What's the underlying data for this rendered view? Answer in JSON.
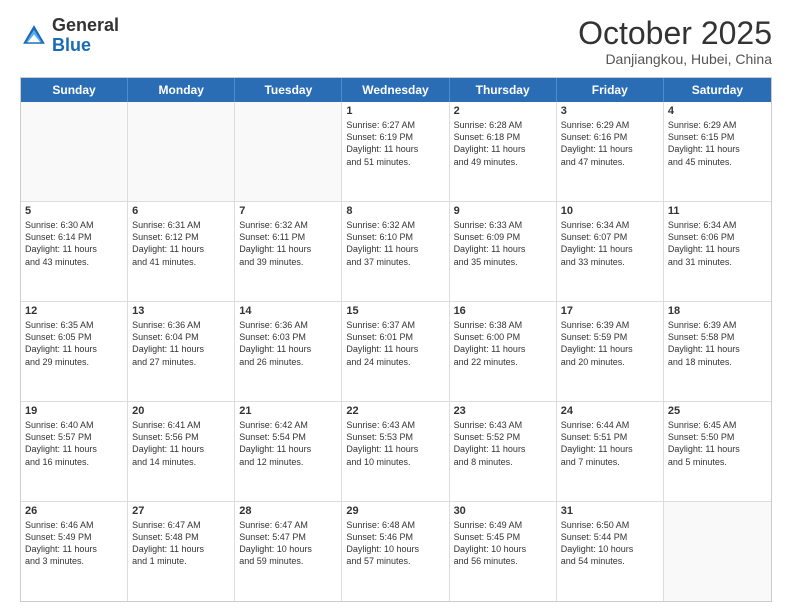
{
  "header": {
    "logo_general": "General",
    "logo_blue": "Blue",
    "month_title": "October 2025",
    "location": "Danjiangkou, Hubei, China"
  },
  "weekdays": [
    "Sunday",
    "Monday",
    "Tuesday",
    "Wednesday",
    "Thursday",
    "Friday",
    "Saturday"
  ],
  "rows": [
    [
      {
        "day": "",
        "text": ""
      },
      {
        "day": "",
        "text": ""
      },
      {
        "day": "",
        "text": ""
      },
      {
        "day": "1",
        "text": "Sunrise: 6:27 AM\nSunset: 6:19 PM\nDaylight: 11 hours\nand 51 minutes."
      },
      {
        "day": "2",
        "text": "Sunrise: 6:28 AM\nSunset: 6:18 PM\nDaylight: 11 hours\nand 49 minutes."
      },
      {
        "day": "3",
        "text": "Sunrise: 6:29 AM\nSunset: 6:16 PM\nDaylight: 11 hours\nand 47 minutes."
      },
      {
        "day": "4",
        "text": "Sunrise: 6:29 AM\nSunset: 6:15 PM\nDaylight: 11 hours\nand 45 minutes."
      }
    ],
    [
      {
        "day": "5",
        "text": "Sunrise: 6:30 AM\nSunset: 6:14 PM\nDaylight: 11 hours\nand 43 minutes."
      },
      {
        "day": "6",
        "text": "Sunrise: 6:31 AM\nSunset: 6:12 PM\nDaylight: 11 hours\nand 41 minutes."
      },
      {
        "day": "7",
        "text": "Sunrise: 6:32 AM\nSunset: 6:11 PM\nDaylight: 11 hours\nand 39 minutes."
      },
      {
        "day": "8",
        "text": "Sunrise: 6:32 AM\nSunset: 6:10 PM\nDaylight: 11 hours\nand 37 minutes."
      },
      {
        "day": "9",
        "text": "Sunrise: 6:33 AM\nSunset: 6:09 PM\nDaylight: 11 hours\nand 35 minutes."
      },
      {
        "day": "10",
        "text": "Sunrise: 6:34 AM\nSunset: 6:07 PM\nDaylight: 11 hours\nand 33 minutes."
      },
      {
        "day": "11",
        "text": "Sunrise: 6:34 AM\nSunset: 6:06 PM\nDaylight: 11 hours\nand 31 minutes."
      }
    ],
    [
      {
        "day": "12",
        "text": "Sunrise: 6:35 AM\nSunset: 6:05 PM\nDaylight: 11 hours\nand 29 minutes."
      },
      {
        "day": "13",
        "text": "Sunrise: 6:36 AM\nSunset: 6:04 PM\nDaylight: 11 hours\nand 27 minutes."
      },
      {
        "day": "14",
        "text": "Sunrise: 6:36 AM\nSunset: 6:03 PM\nDaylight: 11 hours\nand 26 minutes."
      },
      {
        "day": "15",
        "text": "Sunrise: 6:37 AM\nSunset: 6:01 PM\nDaylight: 11 hours\nand 24 minutes."
      },
      {
        "day": "16",
        "text": "Sunrise: 6:38 AM\nSunset: 6:00 PM\nDaylight: 11 hours\nand 22 minutes."
      },
      {
        "day": "17",
        "text": "Sunrise: 6:39 AM\nSunset: 5:59 PM\nDaylight: 11 hours\nand 20 minutes."
      },
      {
        "day": "18",
        "text": "Sunrise: 6:39 AM\nSunset: 5:58 PM\nDaylight: 11 hours\nand 18 minutes."
      }
    ],
    [
      {
        "day": "19",
        "text": "Sunrise: 6:40 AM\nSunset: 5:57 PM\nDaylight: 11 hours\nand 16 minutes."
      },
      {
        "day": "20",
        "text": "Sunrise: 6:41 AM\nSunset: 5:56 PM\nDaylight: 11 hours\nand 14 minutes."
      },
      {
        "day": "21",
        "text": "Sunrise: 6:42 AM\nSunset: 5:54 PM\nDaylight: 11 hours\nand 12 minutes."
      },
      {
        "day": "22",
        "text": "Sunrise: 6:43 AM\nSunset: 5:53 PM\nDaylight: 11 hours\nand 10 minutes."
      },
      {
        "day": "23",
        "text": "Sunrise: 6:43 AM\nSunset: 5:52 PM\nDaylight: 11 hours\nand 8 minutes."
      },
      {
        "day": "24",
        "text": "Sunrise: 6:44 AM\nSunset: 5:51 PM\nDaylight: 11 hours\nand 7 minutes."
      },
      {
        "day": "25",
        "text": "Sunrise: 6:45 AM\nSunset: 5:50 PM\nDaylight: 11 hours\nand 5 minutes."
      }
    ],
    [
      {
        "day": "26",
        "text": "Sunrise: 6:46 AM\nSunset: 5:49 PM\nDaylight: 11 hours\nand 3 minutes."
      },
      {
        "day": "27",
        "text": "Sunrise: 6:47 AM\nSunset: 5:48 PM\nDaylight: 11 hours\nand 1 minute."
      },
      {
        "day": "28",
        "text": "Sunrise: 6:47 AM\nSunset: 5:47 PM\nDaylight: 10 hours\nand 59 minutes."
      },
      {
        "day": "29",
        "text": "Sunrise: 6:48 AM\nSunset: 5:46 PM\nDaylight: 10 hours\nand 57 minutes."
      },
      {
        "day": "30",
        "text": "Sunrise: 6:49 AM\nSunset: 5:45 PM\nDaylight: 10 hours\nand 56 minutes."
      },
      {
        "day": "31",
        "text": "Sunrise: 6:50 AM\nSunset: 5:44 PM\nDaylight: 10 hours\nand 54 minutes."
      },
      {
        "day": "",
        "text": ""
      }
    ]
  ]
}
